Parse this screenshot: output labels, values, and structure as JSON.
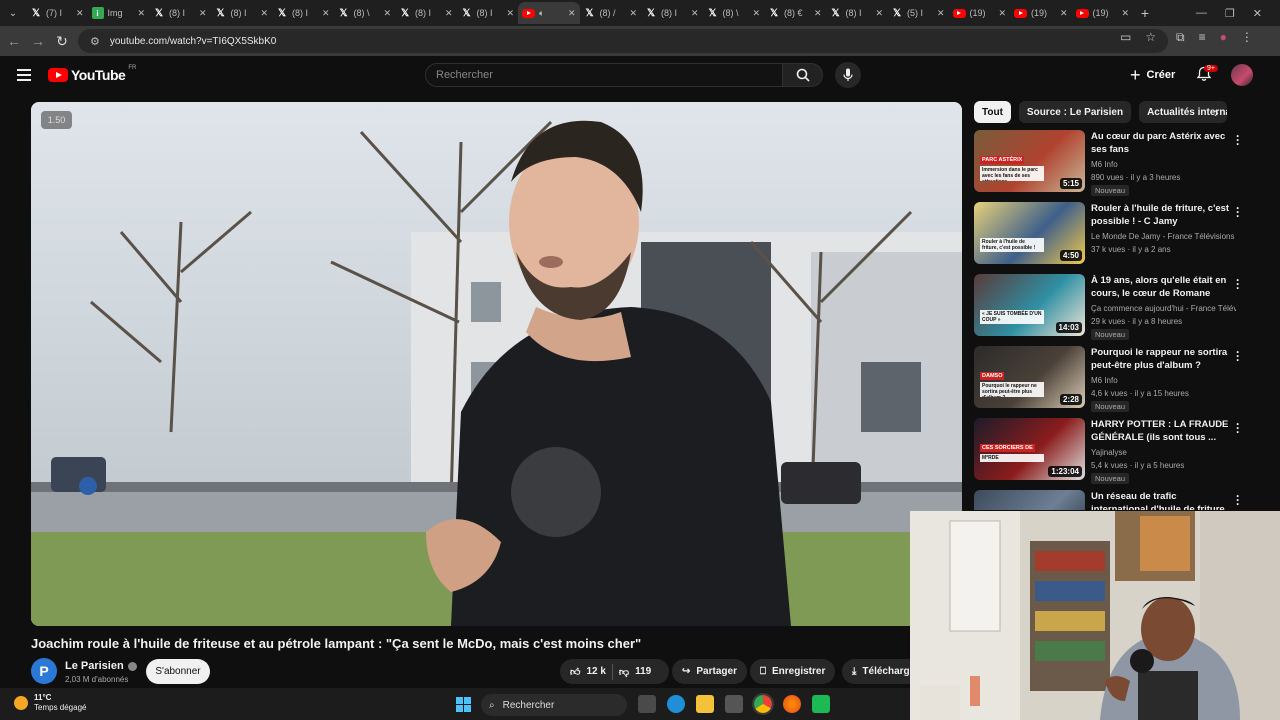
{
  "browser": {
    "tabs": [
      {
        "icon": "x-icon",
        "title": "(7) I"
      },
      {
        "icon": "imgur-icon",
        "title": "Img"
      },
      {
        "icon": "x-icon",
        "title": "(8) I"
      },
      {
        "icon": "x-icon",
        "title": "(8) I"
      },
      {
        "icon": "x-icon",
        "title": "(8) I"
      },
      {
        "icon": "x-icon",
        "title": "(8) \\"
      },
      {
        "icon": "x-icon",
        "title": "(8) I"
      },
      {
        "icon": "x-icon",
        "title": "(8) I"
      },
      {
        "icon": "youtube-icon",
        "title": "",
        "active": true
      },
      {
        "icon": "x-icon",
        "title": "(8) /"
      },
      {
        "icon": "x-icon",
        "title": "(8) I"
      },
      {
        "icon": "x-icon",
        "title": "(8) \\"
      },
      {
        "icon": "x-icon",
        "title": "(8) €"
      },
      {
        "icon": "x-icon",
        "title": "(8) I"
      },
      {
        "icon": "x-icon",
        "title": "(5) I"
      },
      {
        "icon": "youtube-icon",
        "title": "(19)"
      },
      {
        "icon": "youtube-icon",
        "title": "(19)"
      },
      {
        "icon": "youtube-icon",
        "title": "(19)"
      }
    ],
    "url": "youtube.com/watch?v=TI6QX5SkbK0"
  },
  "youtube": {
    "logo_text": "YouTube",
    "logo_region": "FR",
    "search_placeholder": "Rechercher",
    "create_label": "Créer",
    "notif_count": "9+",
    "playback_speed": "1.50",
    "video_title": "Joachim roule à l'huile de friteuse et au pétrole lampant : \"Ça sent le McDo, mais c'est moins cher\"",
    "channel": {
      "initial": "P",
      "name": "Le Parisien",
      "subscribers": "2,03 M d'abonnés"
    },
    "subscribe_label": "S'abonner",
    "likes": "12 k",
    "dislikes": "119",
    "share_label": "Partager",
    "save_label": "Enregistrer",
    "download_label": "Télécharg",
    "chips": [
      "Tout",
      "Source : Le Parisien",
      "Actualités internati"
    ],
    "recommendations": [
      {
        "title": "Au cœur du parc Astérix avec ses fans",
        "channel": "M6 Info",
        "meta": "890 vues · il y a 3 heures",
        "duration": "5:15",
        "badge": "Nouveau",
        "thumb_text": "Immersion dans le parc avec les fans de ses attractions",
        "thumb_tag": "PARC ASTÉRIX",
        "colors": [
          "#7a5c3b",
          "#b0432f",
          "#c9b89a"
        ]
      },
      {
        "title": "Rouler à l'huile de friture, c'est possible ! - C Jamy",
        "channel": "Le Monde De Jamy - France Télévisions",
        "meta": "37 k vues · il y a 2 ans",
        "duration": "4:50",
        "badge": "",
        "thumb_text": "Rouler à l'huile de friture, c'est possible !",
        "thumb_tag": "",
        "colors": [
          "#e8d27a",
          "#3e5f8a",
          "#f2c94c"
        ]
      },
      {
        "title": "À 19 ans, alors qu'elle était en cours, le cœur de Romane s'es...",
        "channel": "Ça commence aujourd'hui - France Télévi...",
        "meta": "29 k vues · il y a 8 heures",
        "duration": "14:03",
        "badge": "Nouveau",
        "thumb_text": "« JE SUIS TOMBÉE D'UN COUP »",
        "thumb_tag": "",
        "colors": [
          "#5a3a3a",
          "#2f8fa3",
          "#f0e6d8"
        ]
      },
      {
        "title": "Pourquoi le rappeur ne sortira peut-être plus d'album ?",
        "channel": "M6 Info",
        "meta": "4,6 k vues · il y a 15 heures",
        "duration": "2:28",
        "badge": "Nouveau",
        "thumb_text": "Pourquoi le rappeur ne sortira peut-être plus d'album ?",
        "thumb_tag": "DAMSO",
        "colors": [
          "#2b2b2b",
          "#4a4038",
          "#d9cbb4"
        ]
      },
      {
        "title": "HARRY POTTER : LA FRAUDE GÉNÉRALE (ils sont tous ...",
        "channel": "Yajinalyse",
        "meta": "5,4 k vues · il y a 5 heures",
        "duration": "1:23:04",
        "badge": "Nouveau",
        "thumb_text": "M*RDE",
        "thumb_tag": "CES SORCIERS DE",
        "colors": [
          "#1c1c2a",
          "#8a1c1c",
          "#e0e0e0"
        ]
      },
      {
        "title": "Un réseau de trafic international d'huile de friture démantelé",
        "channel": "",
        "meta": "",
        "duration": "",
        "badge": "",
        "thumb_text": "",
        "thumb_tag": "",
        "colors": [
          "#3d4a5c",
          "#6d7f94",
          "#1f2a38"
        ]
      }
    ]
  },
  "taskbar": {
    "temperature": "11°C",
    "weather": "Temps dégagé",
    "search_label": "Rechercher"
  }
}
